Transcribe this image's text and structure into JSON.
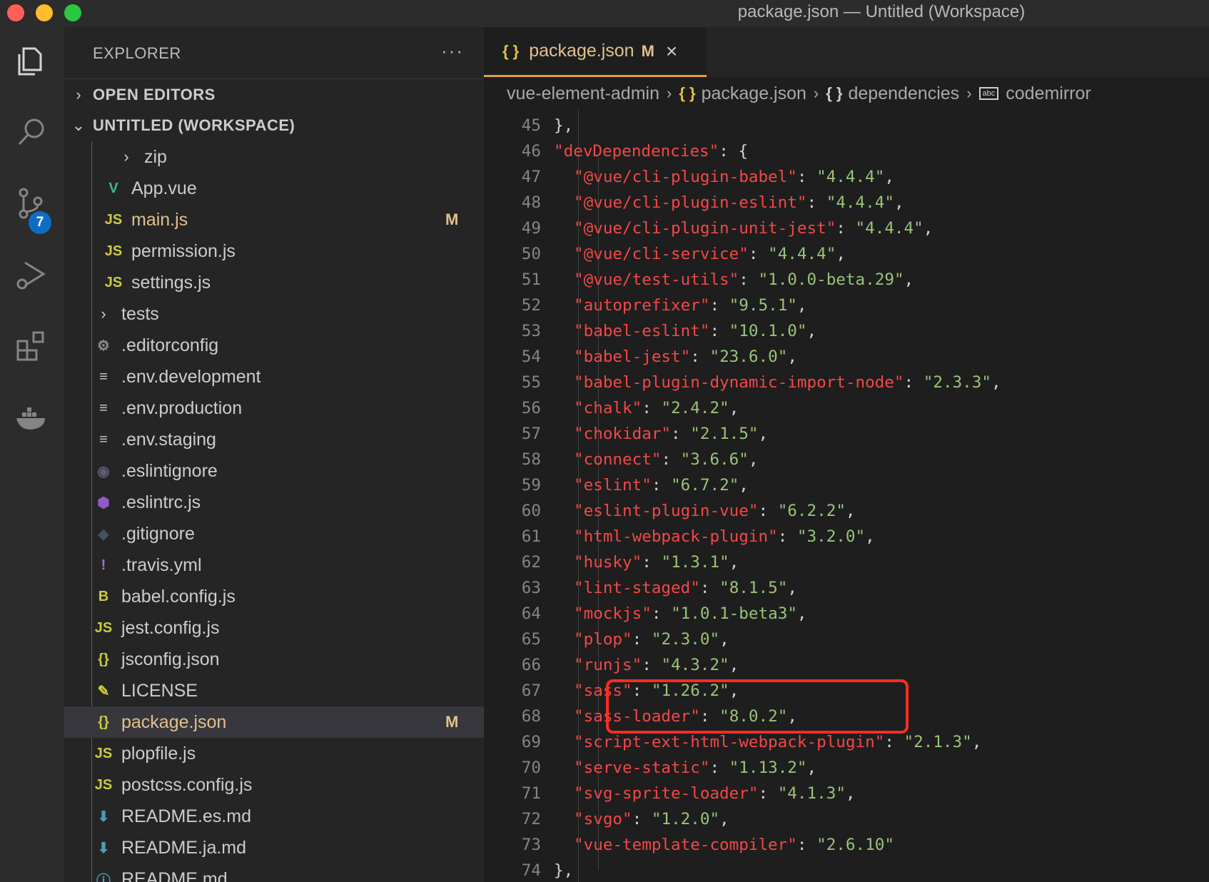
{
  "window": {
    "title": "package.json — Untitled (Workspace)"
  },
  "activity": {
    "scm_badge": "7"
  },
  "sidebar": {
    "title": "EXPLORER",
    "more": "···",
    "open_editors": "OPEN EDITORS",
    "workspace": "UNTITLED (WORKSPACE)",
    "items": [
      {
        "type": "folder",
        "name": "zip",
        "indent": 2
      },
      {
        "type": "file",
        "icon": "V",
        "icon_name": "vue-icon",
        "color": "#41b883",
        "name": "App.vue",
        "indent": 3
      },
      {
        "type": "file",
        "icon": "JS",
        "icon_name": "js-icon",
        "color": "#cbcb41",
        "name": "main.js",
        "indent": 3,
        "modified": "M"
      },
      {
        "type": "file",
        "icon": "JS",
        "icon_name": "js-icon",
        "color": "#cbcb41",
        "name": "permission.js",
        "indent": 3
      },
      {
        "type": "file",
        "icon": "JS",
        "icon_name": "js-icon",
        "color": "#cbcb41",
        "name": "settings.js",
        "indent": 3
      },
      {
        "type": "folder",
        "name": "tests",
        "indent": 1
      },
      {
        "type": "file",
        "icon": "⚙",
        "icon_name": "gear-icon",
        "color": "#8b8b8b",
        "name": ".editorconfig",
        "indent": 1
      },
      {
        "type": "file",
        "icon": "≡",
        "icon_name": "text-file-icon",
        "color": "#cccccc",
        "name": ".env.development",
        "indent": 1
      },
      {
        "type": "file",
        "icon": "≡",
        "icon_name": "text-file-icon",
        "color": "#cccccc",
        "name": ".env.production",
        "indent": 1
      },
      {
        "type": "file",
        "icon": "≡",
        "icon_name": "text-file-icon",
        "color": "#cccccc",
        "name": ".env.staging",
        "indent": 1
      },
      {
        "type": "file",
        "icon": "◉",
        "icon_name": "eslint-ignore-icon",
        "color": "#5c5c6e",
        "name": ".eslintignore",
        "indent": 1
      },
      {
        "type": "file",
        "icon": "⬢",
        "icon_name": "eslint-icon",
        "color": "#8e5cc4",
        "name": ".eslintrc.js",
        "indent": 1
      },
      {
        "type": "file",
        "icon": "◆",
        "icon_name": "git-icon",
        "color": "#41535b",
        "name": ".gitignore",
        "indent": 1
      },
      {
        "type": "file",
        "icon": "!",
        "icon_name": "yaml-icon",
        "color": "#a074c4",
        "name": ".travis.yml",
        "indent": 1
      },
      {
        "type": "file",
        "icon": "B",
        "icon_name": "babel-icon",
        "color": "#cbcb41",
        "name": "babel.config.js",
        "indent": 1
      },
      {
        "type": "file",
        "icon": "JS",
        "icon_name": "js-icon",
        "color": "#cbcb41",
        "name": "jest.config.js",
        "indent": 1
      },
      {
        "type": "file",
        "icon": "{}",
        "icon_name": "json-icon",
        "color": "#cbcb41",
        "name": "jsconfig.json",
        "indent": 1
      },
      {
        "type": "file",
        "icon": "✎",
        "icon_name": "license-icon",
        "color": "#cbcb41",
        "name": "LICENSE",
        "indent": 1
      },
      {
        "type": "file",
        "icon": "{}",
        "icon_name": "json-icon",
        "color": "#cbcb41",
        "name": "package.json",
        "indent": 1,
        "modified": "M",
        "selected": true
      },
      {
        "type": "file",
        "icon": "JS",
        "icon_name": "js-icon",
        "color": "#cbcb41",
        "name": "plopfile.js",
        "indent": 1
      },
      {
        "type": "file",
        "icon": "JS",
        "icon_name": "js-icon",
        "color": "#cbcb41",
        "name": "postcss.config.js",
        "indent": 1
      },
      {
        "type": "file",
        "icon": "⬇",
        "icon_name": "markdown-icon",
        "color": "#519aba",
        "name": "README.es.md",
        "indent": 1
      },
      {
        "type": "file",
        "icon": "⬇",
        "icon_name": "markdown-icon",
        "color": "#519aba",
        "name": "README.ja.md",
        "indent": 1
      },
      {
        "type": "file",
        "icon": "ⓘ",
        "icon_name": "info-icon",
        "color": "#519aba",
        "name": "README.md",
        "indent": 1
      }
    ]
  },
  "editor": {
    "tab": {
      "icon": "{ }",
      "label": "package.json",
      "modified": "M",
      "close": "×"
    },
    "breadcrumb": {
      "project": "vue-element-admin",
      "file": "package.json",
      "file_icon": "{ }",
      "section": "dependencies",
      "section_icon": "{ }",
      "symbol": "codemirror",
      "symbol_icon": "abc",
      "separator": "›"
    },
    "lines": [
      {
        "n": "45",
        "indent": 0,
        "raw": "},"
      },
      {
        "n": "46",
        "indent": 0,
        "key": "devDependencies",
        "raw": ": {"
      },
      {
        "n": "47",
        "indent": 1,
        "key": "@vue/cli-plugin-babel",
        "value": "4.4.4",
        "end": ","
      },
      {
        "n": "48",
        "indent": 1,
        "key": "@vue/cli-plugin-eslint",
        "value": "4.4.4",
        "end": ","
      },
      {
        "n": "49",
        "indent": 1,
        "key": "@vue/cli-plugin-unit-jest",
        "value": "4.4.4",
        "end": ","
      },
      {
        "n": "50",
        "indent": 1,
        "key": "@vue/cli-service",
        "value": "4.4.4",
        "end": ","
      },
      {
        "n": "51",
        "indent": 1,
        "key": "@vue/test-utils",
        "value": "1.0.0-beta.29",
        "end": ","
      },
      {
        "n": "52",
        "indent": 1,
        "key": "autoprefixer",
        "value": "9.5.1",
        "end": ","
      },
      {
        "n": "53",
        "indent": 1,
        "key": "babel-eslint",
        "value": "10.1.0",
        "end": ","
      },
      {
        "n": "54",
        "indent": 1,
        "key": "babel-jest",
        "value": "23.6.0",
        "end": ","
      },
      {
        "n": "55",
        "indent": 1,
        "key": "babel-plugin-dynamic-import-node",
        "value": "2.3.3",
        "end": ","
      },
      {
        "n": "56",
        "indent": 1,
        "key": "chalk",
        "value": "2.4.2",
        "end": ","
      },
      {
        "n": "57",
        "indent": 1,
        "key": "chokidar",
        "value": "2.1.5",
        "end": ","
      },
      {
        "n": "58",
        "indent": 1,
        "key": "connect",
        "value": "3.6.6",
        "end": ","
      },
      {
        "n": "59",
        "indent": 1,
        "key": "eslint",
        "value": "6.7.2",
        "end": ","
      },
      {
        "n": "60",
        "indent": 1,
        "key": "eslint-plugin-vue",
        "value": "6.2.2",
        "end": ","
      },
      {
        "n": "61",
        "indent": 1,
        "key": "html-webpack-plugin",
        "value": "3.2.0",
        "end": ","
      },
      {
        "n": "62",
        "indent": 1,
        "key": "husky",
        "value": "1.3.1",
        "end": ","
      },
      {
        "n": "63",
        "indent": 1,
        "key": "lint-staged",
        "value": "8.1.5",
        "end": ","
      },
      {
        "n": "64",
        "indent": 1,
        "key": "mockjs",
        "value": "1.0.1-beta3",
        "end": ","
      },
      {
        "n": "65",
        "indent": 1,
        "key": "plop",
        "value": "2.3.0",
        "end": ","
      },
      {
        "n": "66",
        "indent": 1,
        "key": "runjs",
        "value": "4.3.2",
        "end": ","
      },
      {
        "n": "67",
        "indent": 1,
        "key": "sass",
        "value": "1.26.2",
        "end": ","
      },
      {
        "n": "68",
        "indent": 1,
        "key": "sass-loader",
        "value": "8.0.2",
        "end": ","
      },
      {
        "n": "69",
        "indent": 1,
        "key": "script-ext-html-webpack-plugin",
        "value": "2.1.3",
        "end": ","
      },
      {
        "n": "70",
        "indent": 1,
        "key": "serve-static",
        "value": "1.13.2",
        "end": ","
      },
      {
        "n": "71",
        "indent": 1,
        "key": "svg-sprite-loader",
        "value": "4.1.3",
        "end": ","
      },
      {
        "n": "72",
        "indent": 1,
        "key": "svgo",
        "value": "1.2.0",
        "end": ","
      },
      {
        "n": "73",
        "indent": 1,
        "key": "vue-template-compiler",
        "value": "2.6.10",
        "end": ""
      },
      {
        "n": "74",
        "indent": 0,
        "raw": "},"
      }
    ]
  }
}
